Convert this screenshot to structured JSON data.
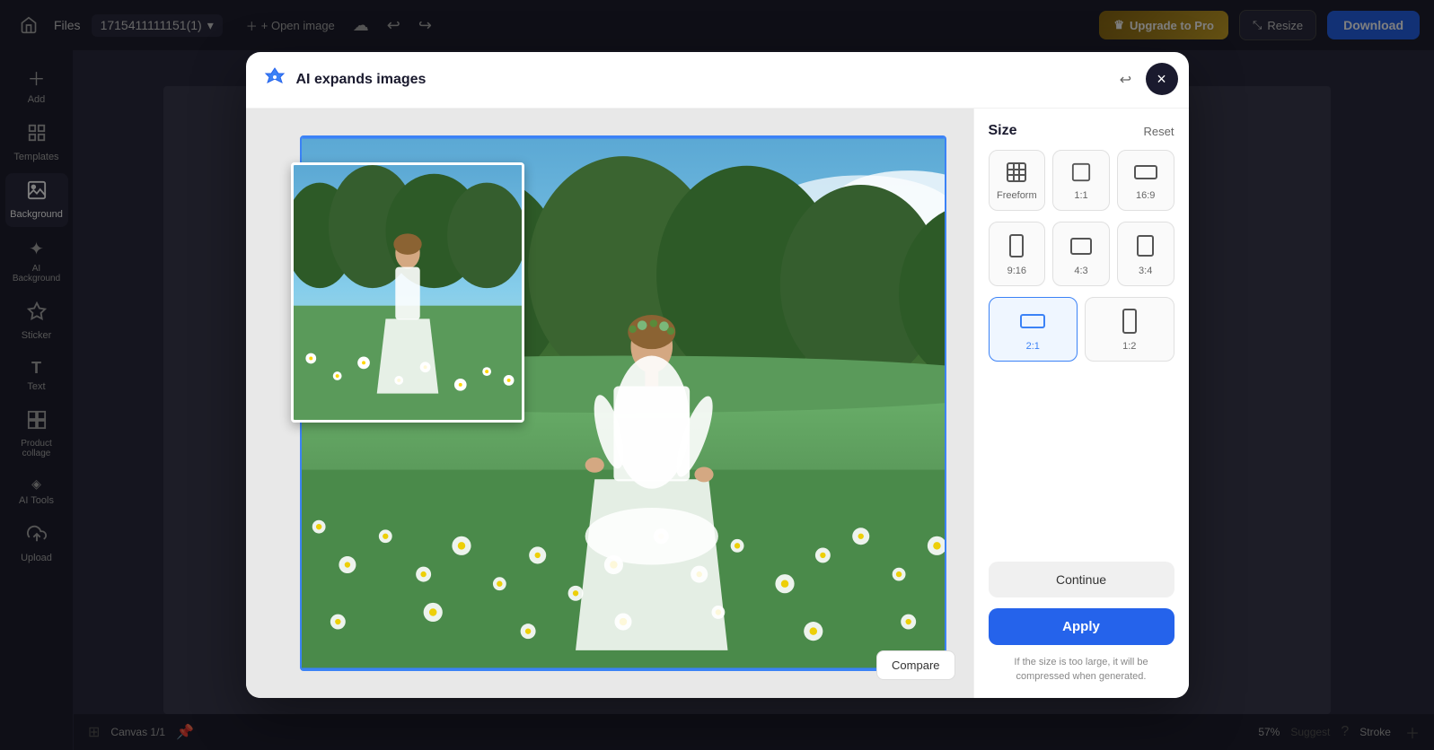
{
  "topbar": {
    "home_icon": "⌂",
    "files_label": "Files",
    "filename": "1715411111151(1)",
    "open_image_label": "+ Open image",
    "upgrade_label": "Upgrade to Pro",
    "resize_label": "Resize",
    "download_label": "Download"
  },
  "sidebar": {
    "items": [
      {
        "id": "add",
        "icon": "+",
        "label": "Add"
      },
      {
        "id": "templates",
        "icon": "⊞",
        "label": "Templates"
      },
      {
        "id": "background",
        "icon": "▣",
        "label": "Background",
        "active": true
      },
      {
        "id": "ai-background",
        "icon": "✦",
        "label": "AI Background"
      },
      {
        "id": "sticker",
        "icon": "★",
        "label": "Sticker"
      },
      {
        "id": "text",
        "icon": "T",
        "label": "Text"
      },
      {
        "id": "product-collage",
        "icon": "⧉",
        "label": "Product collage"
      },
      {
        "id": "ai-tools",
        "icon": "◈",
        "label": "AI Tools"
      },
      {
        "id": "upload",
        "icon": "↑",
        "label": "Upload"
      }
    ]
  },
  "modal": {
    "title": "AI expands images",
    "close_icon": "×",
    "undo_icon": "↩",
    "redo_icon": "↪",
    "compare_label": "Compare",
    "panel": {
      "title": "Size",
      "reset_label": "Reset",
      "size_options": [
        {
          "id": "freeform",
          "label": "Freeform",
          "active": false
        },
        {
          "id": "1:1",
          "label": "1:1",
          "active": false
        },
        {
          "id": "16:9",
          "label": "16:9",
          "active": false
        },
        {
          "id": "9:16",
          "label": "9:16",
          "active": false
        },
        {
          "id": "4:3",
          "label": "4:3",
          "active": false
        },
        {
          "id": "3:4",
          "label": "3:4",
          "active": false
        },
        {
          "id": "2:1",
          "label": "2:1",
          "active": true
        },
        {
          "id": "1:2",
          "label": "1:2",
          "active": false
        }
      ],
      "continue_label": "Continue",
      "apply_label": "Apply",
      "note": "If the size is too large, it will be compressed when generated."
    }
  },
  "bottom_bar": {
    "canvas_label": "Canvas 1/1",
    "zoom_label": "57%",
    "suggest_label": "Suggest",
    "stroke_label": "Stroke"
  }
}
